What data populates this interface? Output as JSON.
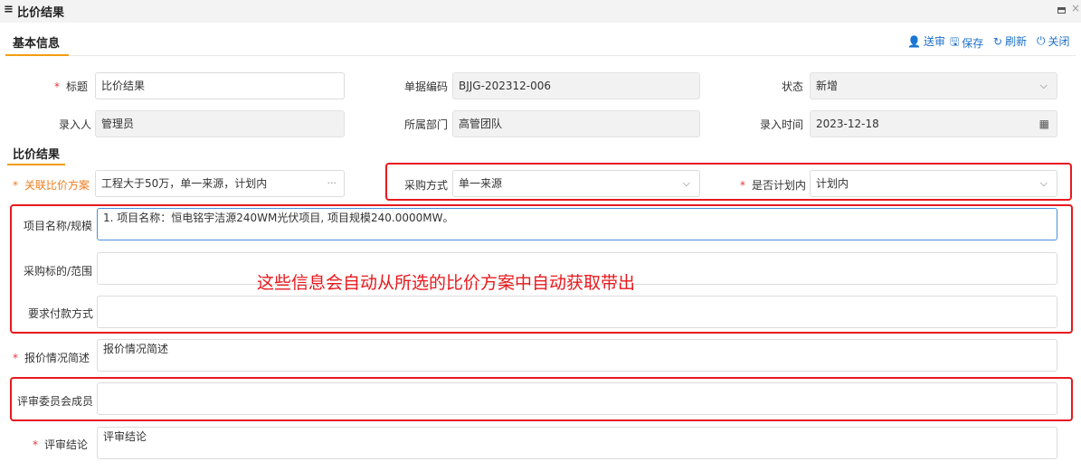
{
  "window": {
    "menu_icon": "≡",
    "title": "比价结果",
    "maximize_icon": "maximize-icon",
    "close_icon": "×"
  },
  "basic_section": {
    "title": "基本信息"
  },
  "toolbar": {
    "send_icon": "👤",
    "send_label": "送审",
    "save_icon": "🖫",
    "save_label": "保存",
    "refresh_icon": "↻",
    "refresh_label": "刷新",
    "close_icon": "⏻",
    "close_label": "关闭"
  },
  "fields": {
    "title": {
      "required": "*",
      "label": "标题",
      "value": "比价结果"
    },
    "doc_code": {
      "label": "单据编码",
      "value": "BJJG-202312-006"
    },
    "status": {
      "label": "状态",
      "value": "新增"
    },
    "entry_person": {
      "label": "录入人",
      "value": "管理员"
    },
    "department": {
      "label": "所属部门",
      "value": "高管团队"
    },
    "entry_time": {
      "label": "录入时间",
      "value": "2023-12-18"
    }
  },
  "result_section": {
    "title": "比价结果"
  },
  "result_fields": {
    "plan": {
      "required": "*",
      "label": "关联比价方案",
      "value": "工程大于50万，单一来源，计划内",
      "more": "···"
    },
    "purchase_method": {
      "label": "采购方式",
      "value": "单一来源"
    },
    "in_plan": {
      "required": "*",
      "label": "是否计划内",
      "value": "计划内"
    },
    "project_name": {
      "label": "项目名称/规模",
      "value": "1. 项目名称：恒电铭宇洁源240WM光伏项目, 项目规模240.0000MW。"
    },
    "purchase_scope": {
      "label": "采购标的/范围",
      "value": ""
    },
    "payment": {
      "label": "要求付款方式",
      "value": ""
    },
    "quote_summary": {
      "required": "*",
      "label": "报价情况简述",
      "value": "报价情况简述"
    },
    "committee": {
      "label": "评审委员会成员",
      "value": ""
    },
    "conclusion": {
      "required": "*",
      "label": "评审结论",
      "value": "评审结论"
    }
  },
  "annotation": "这些信息会自动从所选的比价方案中自动获取带出",
  "colors": {
    "accent": "#f39c12",
    "link": "#1e6fc9",
    "annotation": "#e8191d",
    "required": "#e4393c"
  }
}
